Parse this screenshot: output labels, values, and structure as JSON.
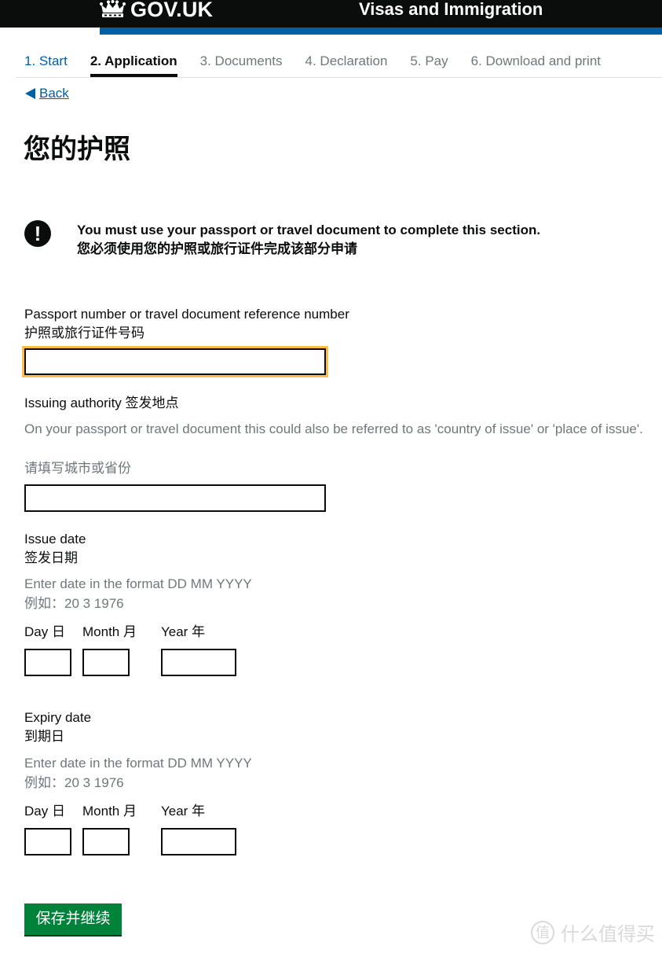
{
  "header": {
    "logo_text": "GOV.UK",
    "service_name": "Visas and Immigration",
    "colors": {
      "header_bg": "#0b0c0c",
      "accent_bar": "#005ea5"
    }
  },
  "steps": [
    {
      "label": "1. Start",
      "state": "done"
    },
    {
      "label": "2. Application",
      "state": "current"
    },
    {
      "label": "3. Documents",
      "state": "upcoming"
    },
    {
      "label": "4. Declaration",
      "state": "upcoming"
    },
    {
      "label": "5. Pay",
      "state": "upcoming"
    },
    {
      "label": "6. Download and print",
      "state": "upcoming"
    }
  ],
  "back_link": {
    "icon": "triangle-left-icon",
    "label": "Back"
  },
  "page_title": "您的护照",
  "warning": {
    "icon": "exclamation-icon",
    "icon_glyph": "!",
    "line_en": "You must use your passport or travel document to complete this section.",
    "line_zh": "您必须使用您的护照或旅行证件完成该部分申请"
  },
  "fields": {
    "passport_number": {
      "label_en": "Passport number or travel document reference number",
      "label_zh": "护照或旅行证件号码",
      "value": ""
    },
    "issuing_authority": {
      "label": "Issuing authority 签发地点",
      "hint_en": "On your passport or travel document this could also be referred to as 'country of issue' or 'place of issue'.",
      "hint_zh": "请填写城市或省份",
      "value": ""
    },
    "issue_date": {
      "label_en": "Issue date",
      "label_zh": "签发日期",
      "hint_en": "Enter date in the format DD MM YYYY",
      "hint_zh": "例如：20 3 1976",
      "day_label": "Day 日",
      "month_label": "Month 月",
      "year_label": "Year 年",
      "day": "",
      "month": "",
      "year": ""
    },
    "expiry_date": {
      "label_en": "Expiry date",
      "label_zh": "到期日",
      "hint_en": "Enter date in the format DD MM YYYY",
      "hint_zh": "例如：20 3 1976",
      "day_label": "Day 日",
      "month_label": "Month 月",
      "year_label": "Year 年",
      "day": "",
      "month": "",
      "year": ""
    }
  },
  "submit_button": {
    "label": "保存并继续",
    "color": "#00823b"
  },
  "watermark": {
    "icon_glyph": "值",
    "text": "什么值得买"
  }
}
